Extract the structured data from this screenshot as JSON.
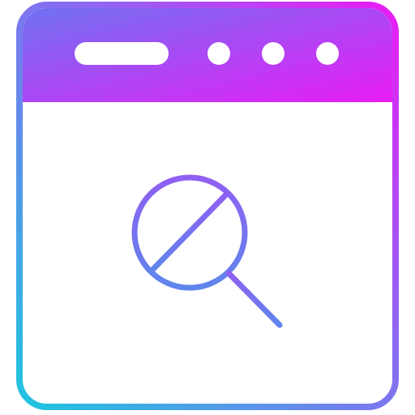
{
  "icon": {
    "name": "browser-search-blocked-icon",
    "gradient": {
      "header_start": "#6f72f2",
      "header_end": "#e91cf5",
      "border_bottom_left": "#20c5df",
      "border_bottom_right": "#8f66f2",
      "magnifier_top": "#8f5ff3",
      "magnifier_bottom": "#5f86ec"
    },
    "elements": {
      "title_bar": "window-title-bar",
      "address_bar": "address-bar-pill",
      "window_dots": [
        "window-dot-1",
        "window-dot-2",
        "window-dot-3"
      ],
      "search_icon": "magnifier-icon",
      "blocked_slash": "blocked-slash-icon"
    }
  }
}
